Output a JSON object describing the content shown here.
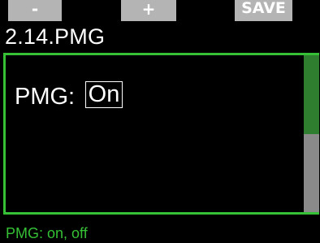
{
  "softkeys": {
    "minus": "-",
    "plus": "+",
    "save": "SAVE"
  },
  "title": "2.14.PMG",
  "setting": {
    "label": "PMG:",
    "value": "On"
  },
  "scrollbar": {
    "visible_fraction": 0.5
  },
  "status": "PMG: on, off",
  "colors": {
    "accent": "#35c035",
    "softkey_bg": "#b4b4b4",
    "scroll_thumb": "#2f7d2f",
    "scroll_track": "#8a8a8a"
  }
}
